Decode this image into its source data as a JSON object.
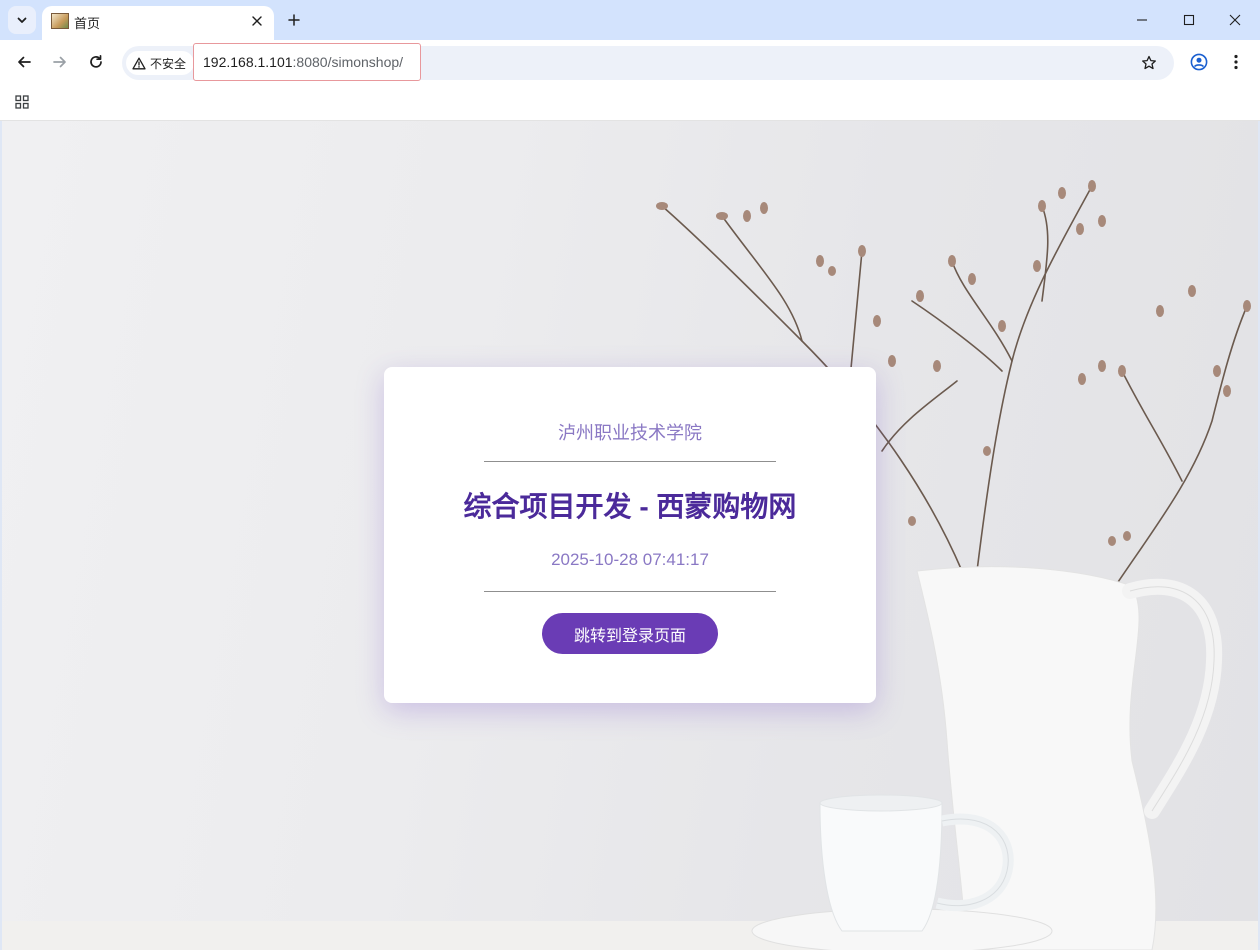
{
  "browser": {
    "tab": {
      "title": "首页"
    },
    "omnibox": {
      "security_label": "不安全",
      "url_host": "192.168.1.101",
      "url_rest": ":8080/simonshop/"
    },
    "icons": {
      "tab_menu": "chevron-down-icon",
      "tab_close": "close-icon",
      "new_tab": "plus-icon",
      "minimize": "minimize-icon",
      "maximize": "maximize-icon",
      "close_window": "close-icon",
      "back": "arrow-left-icon",
      "forward": "arrow-right-icon",
      "reload": "reload-icon",
      "security": "warning-icon",
      "bookmark": "star-icon",
      "profile": "profile-icon",
      "menu": "kebab-menu-icon",
      "apps": "apps-grid-icon"
    }
  },
  "page": {
    "school": "泸州职业技术学院",
    "title": "综合项目开发 - 西蒙购物网",
    "datetime": "2025-10-28 07:41:17",
    "login_button": "跳转到登录页面"
  },
  "colors": {
    "title_text": "#4b2a9a",
    "subtle_text": "#8a78c4",
    "button_bg": "#6a3cb5",
    "url_highlight_border": "#e8989c"
  }
}
